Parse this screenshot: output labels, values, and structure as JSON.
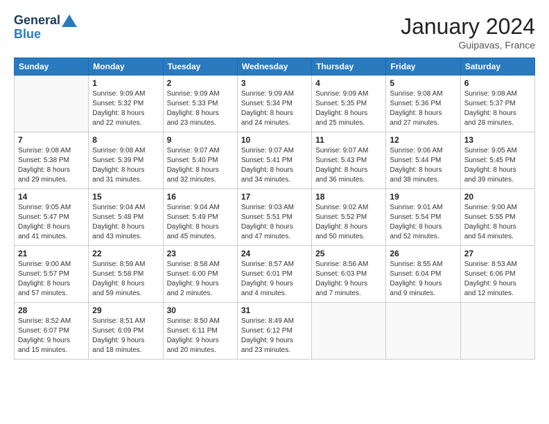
{
  "header": {
    "logo_line1": "General",
    "logo_line2": "Blue",
    "month": "January 2024",
    "location": "Guipavas, France"
  },
  "weekdays": [
    "Sunday",
    "Monday",
    "Tuesday",
    "Wednesday",
    "Thursday",
    "Friday",
    "Saturday"
  ],
  "weeks": [
    [
      {
        "day": "",
        "info": ""
      },
      {
        "day": "1",
        "info": "Sunrise: 9:09 AM\nSunset: 5:32 PM\nDaylight: 8 hours\nand 22 minutes."
      },
      {
        "day": "2",
        "info": "Sunrise: 9:09 AM\nSunset: 5:33 PM\nDaylight: 8 hours\nand 23 minutes."
      },
      {
        "day": "3",
        "info": "Sunrise: 9:09 AM\nSunset: 5:34 PM\nDaylight: 8 hours\nand 24 minutes."
      },
      {
        "day": "4",
        "info": "Sunrise: 9:09 AM\nSunset: 5:35 PM\nDaylight: 8 hours\nand 25 minutes."
      },
      {
        "day": "5",
        "info": "Sunrise: 9:08 AM\nSunset: 5:36 PM\nDaylight: 8 hours\nand 27 minutes."
      },
      {
        "day": "6",
        "info": "Sunrise: 9:08 AM\nSunset: 5:37 PM\nDaylight: 8 hours\nand 28 minutes."
      }
    ],
    [
      {
        "day": "7",
        "info": "Sunrise: 9:08 AM\nSunset: 5:38 PM\nDaylight: 8 hours\nand 29 minutes."
      },
      {
        "day": "8",
        "info": "Sunrise: 9:08 AM\nSunset: 5:39 PM\nDaylight: 8 hours\nand 31 minutes."
      },
      {
        "day": "9",
        "info": "Sunrise: 9:07 AM\nSunset: 5:40 PM\nDaylight: 8 hours\nand 32 minutes."
      },
      {
        "day": "10",
        "info": "Sunrise: 9:07 AM\nSunset: 5:41 PM\nDaylight: 8 hours\nand 34 minutes."
      },
      {
        "day": "11",
        "info": "Sunrise: 9:07 AM\nSunset: 5:43 PM\nDaylight: 8 hours\nand 36 minutes."
      },
      {
        "day": "12",
        "info": "Sunrise: 9:06 AM\nSunset: 5:44 PM\nDaylight: 8 hours\nand 38 minutes."
      },
      {
        "day": "13",
        "info": "Sunrise: 9:05 AM\nSunset: 5:45 PM\nDaylight: 8 hours\nand 39 minutes."
      }
    ],
    [
      {
        "day": "14",
        "info": "Sunrise: 9:05 AM\nSunset: 5:47 PM\nDaylight: 8 hours\nand 41 minutes."
      },
      {
        "day": "15",
        "info": "Sunrise: 9:04 AM\nSunset: 5:48 PM\nDaylight: 8 hours\nand 43 minutes."
      },
      {
        "day": "16",
        "info": "Sunrise: 9:04 AM\nSunset: 5:49 PM\nDaylight: 8 hours\nand 45 minutes."
      },
      {
        "day": "17",
        "info": "Sunrise: 9:03 AM\nSunset: 5:51 PM\nDaylight: 8 hours\nand 47 minutes."
      },
      {
        "day": "18",
        "info": "Sunrise: 9:02 AM\nSunset: 5:52 PM\nDaylight: 8 hours\nand 50 minutes."
      },
      {
        "day": "19",
        "info": "Sunrise: 9:01 AM\nSunset: 5:54 PM\nDaylight: 8 hours\nand 52 minutes."
      },
      {
        "day": "20",
        "info": "Sunrise: 9:00 AM\nSunset: 5:55 PM\nDaylight: 8 hours\nand 54 minutes."
      }
    ],
    [
      {
        "day": "21",
        "info": "Sunrise: 9:00 AM\nSunset: 5:57 PM\nDaylight: 8 hours\nand 57 minutes."
      },
      {
        "day": "22",
        "info": "Sunrise: 8:59 AM\nSunset: 5:58 PM\nDaylight: 8 hours\nand 59 minutes."
      },
      {
        "day": "23",
        "info": "Sunrise: 8:58 AM\nSunset: 6:00 PM\nDaylight: 9 hours\nand 2 minutes."
      },
      {
        "day": "24",
        "info": "Sunrise: 8:57 AM\nSunset: 6:01 PM\nDaylight: 9 hours\nand 4 minutes."
      },
      {
        "day": "25",
        "info": "Sunrise: 8:56 AM\nSunset: 6:03 PM\nDaylight: 9 hours\nand 7 minutes."
      },
      {
        "day": "26",
        "info": "Sunrise: 8:55 AM\nSunset: 6:04 PM\nDaylight: 9 hours\nand 9 minutes."
      },
      {
        "day": "27",
        "info": "Sunrise: 8:53 AM\nSunset: 6:06 PM\nDaylight: 9 hours\nand 12 minutes."
      }
    ],
    [
      {
        "day": "28",
        "info": "Sunrise: 8:52 AM\nSunset: 6:07 PM\nDaylight: 9 hours\nand 15 minutes."
      },
      {
        "day": "29",
        "info": "Sunrise: 8:51 AM\nSunset: 6:09 PM\nDaylight: 9 hours\nand 18 minutes."
      },
      {
        "day": "30",
        "info": "Sunrise: 8:50 AM\nSunset: 6:11 PM\nDaylight: 9 hours\nand 20 minutes."
      },
      {
        "day": "31",
        "info": "Sunrise: 8:49 AM\nSunset: 6:12 PM\nDaylight: 9 hours\nand 23 minutes."
      },
      {
        "day": "",
        "info": ""
      },
      {
        "day": "",
        "info": ""
      },
      {
        "day": "",
        "info": ""
      }
    ]
  ]
}
